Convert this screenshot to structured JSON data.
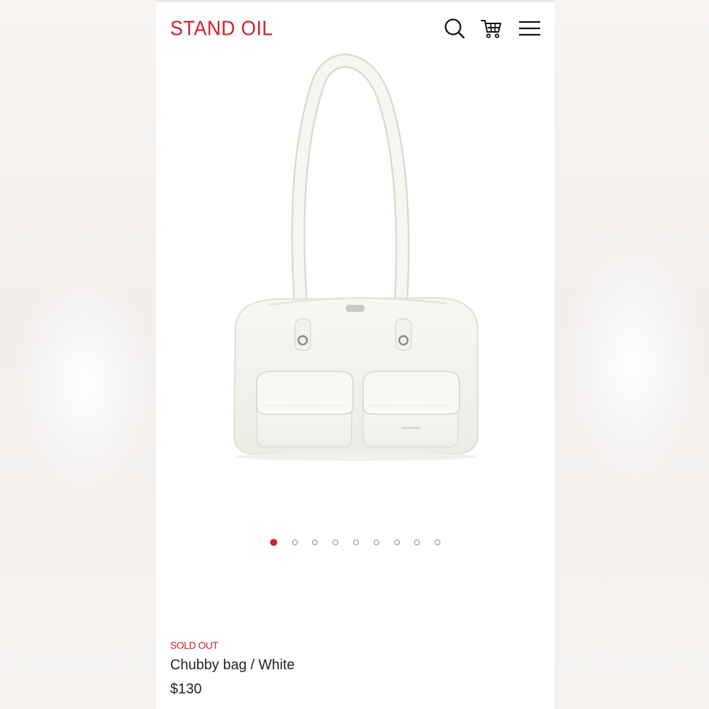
{
  "brand": {
    "logo_text": "STAND OIL",
    "accent_color": "#d0202a"
  },
  "header": {
    "icons": [
      "search-icon",
      "cart-icon",
      "menu-icon"
    ]
  },
  "carousel": {
    "total_slides": 9,
    "active_index": 0,
    "active_color": "#d0202a",
    "image_subject": "white shoulder bag with two front pockets"
  },
  "product": {
    "status": "SOLD OUT",
    "name": "Chubby bag / White",
    "price": "$130"
  }
}
